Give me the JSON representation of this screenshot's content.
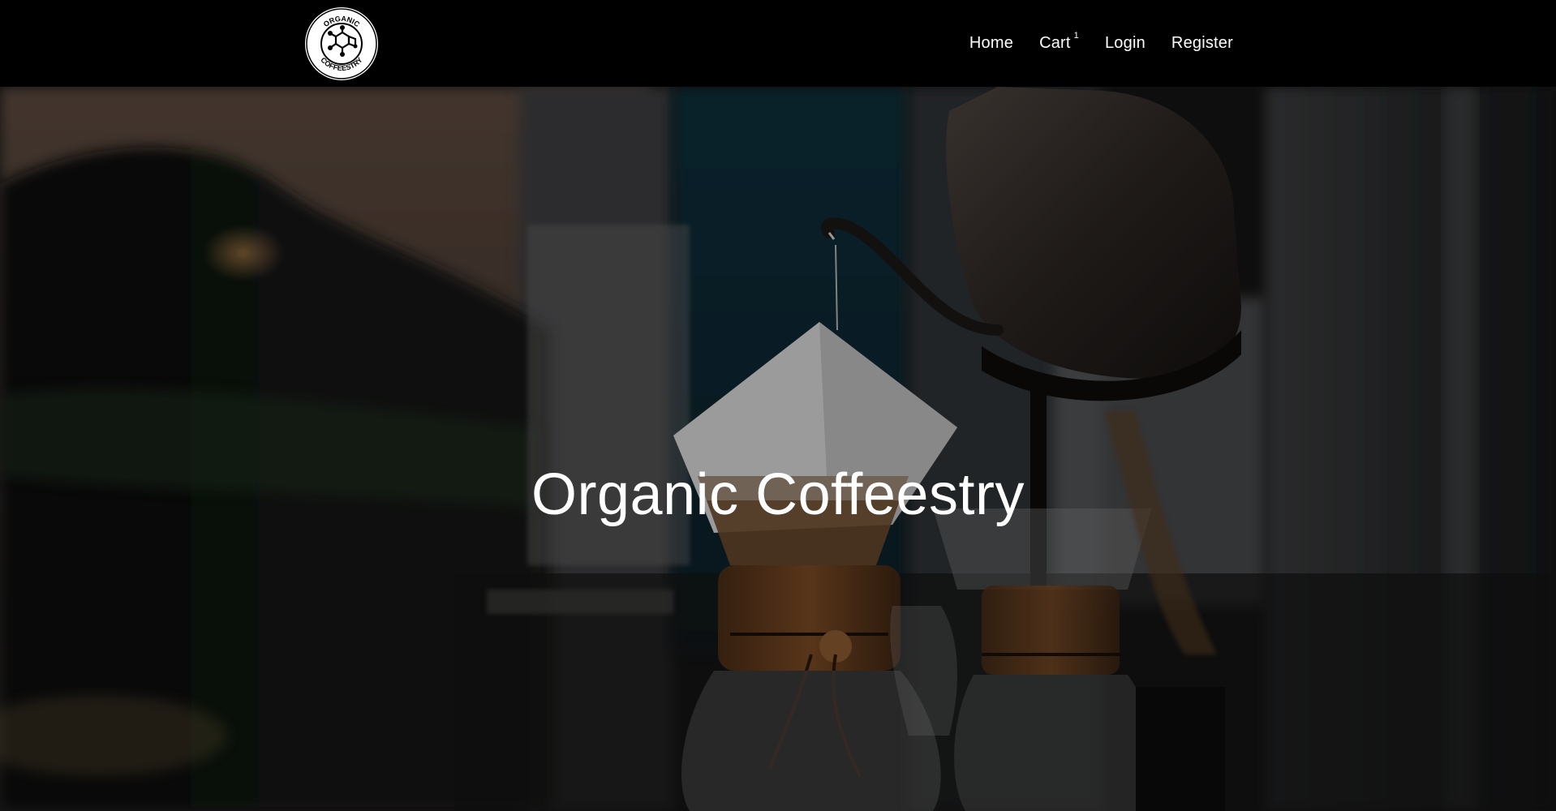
{
  "brand": {
    "logo_text_top": "ORGANIC",
    "logo_text_bottom": "COFFEESTRY",
    "icon": "molecule-logo-icon"
  },
  "nav": {
    "home": "Home",
    "cart": "Cart",
    "cart_count": "1",
    "login": "Login",
    "register": "Register"
  },
  "hero": {
    "title": "Organic Coffeestry",
    "image": "coffee-pour-over-photo"
  },
  "colors": {
    "navbar_bg": "#000000",
    "text": "#ffffff"
  }
}
